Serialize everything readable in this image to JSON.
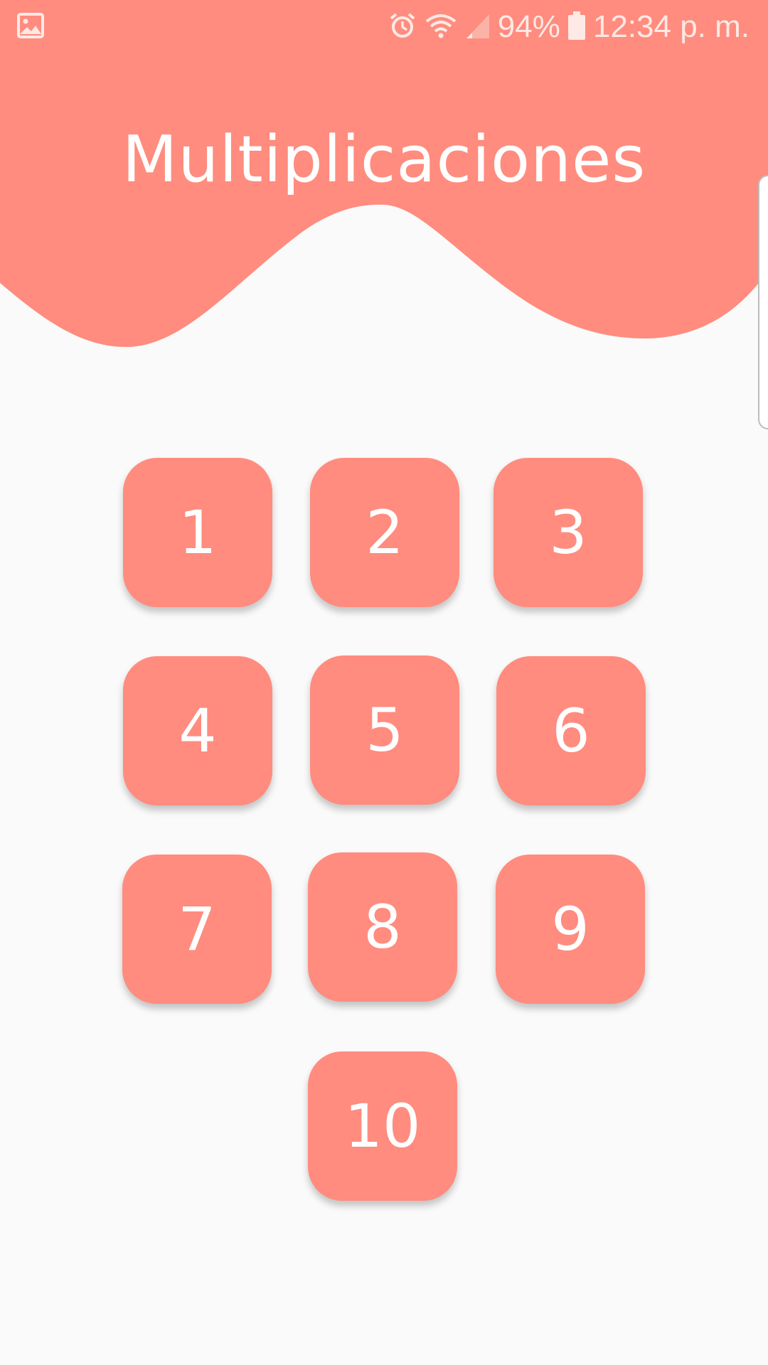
{
  "status_bar": {
    "gallery_icon": "image-icon",
    "alarm_icon": "alarm-icon",
    "wifi_icon": "wifi-icon",
    "signal_icon": "signal-icon",
    "battery_percent": "94%",
    "battery_icon": "battery-icon",
    "time": "12:34 p. m."
  },
  "header": {
    "title": "Multiplicaciones"
  },
  "tables": {
    "buttons": [
      {
        "label": "1"
      },
      {
        "label": "2"
      },
      {
        "label": "3"
      },
      {
        "label": "4"
      },
      {
        "label": "5"
      },
      {
        "label": "6"
      },
      {
        "label": "7"
      },
      {
        "label": "8"
      },
      {
        "label": "9"
      },
      {
        "label": "10"
      }
    ]
  },
  "colors": {
    "accent": "#ff8c7e",
    "background": "#fafafa",
    "text_on_accent": "#ffffff"
  }
}
